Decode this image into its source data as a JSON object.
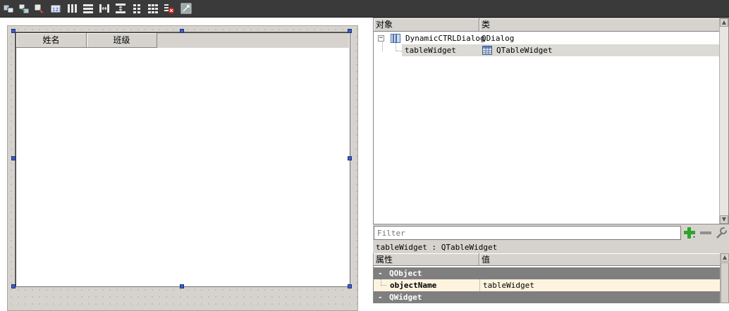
{
  "toolbar": {
    "buttons": [
      {
        "name": "edit-widgets",
        "icon": "edit-widgets-icon"
      },
      {
        "name": "edit-signals-slots",
        "icon": "signals-slots-icon"
      },
      {
        "name": "edit-buddies",
        "icon": "buddies-icon"
      },
      {
        "name": "edit-tab-order",
        "icon": "tab-order-icon"
      },
      {
        "name": "layout-horizontal",
        "icon": "layout-horizontal-icon"
      },
      {
        "name": "layout-vertical",
        "icon": "layout-vertical-icon"
      },
      {
        "name": "layout-horizontal-splitter",
        "icon": "splitter-horizontal-icon"
      },
      {
        "name": "layout-vertical-splitter",
        "icon": "splitter-vertical-icon"
      },
      {
        "name": "layout-form",
        "icon": "layout-form-icon"
      },
      {
        "name": "layout-grid",
        "icon": "layout-grid-icon"
      },
      {
        "name": "break-layout",
        "icon": "break-layout-icon"
      },
      {
        "name": "adjust-size",
        "icon": "adjust-size-icon"
      }
    ]
  },
  "form": {
    "table": {
      "columns": [
        "姓名",
        "班级"
      ]
    }
  },
  "object_inspector": {
    "headers": {
      "object": "对象",
      "class": "类"
    },
    "tree": [
      {
        "object": "DynamicCTRLDialog",
        "class": "QDialog",
        "icon": "dialog-icon",
        "expanded": true
      },
      {
        "object": "tableWidget",
        "class": "QTableWidget",
        "icon": "table-widget-icon",
        "selected": true
      }
    ]
  },
  "property_editor": {
    "filter_placeholder": "Filter",
    "add_icon": "plus-icon",
    "remove_icon": "minus-icon",
    "configure_icon": "wrench-icon",
    "current_object": "tableWidget : QTableWidget",
    "headers": {
      "property": "属性",
      "value": "值"
    },
    "groups": [
      {
        "name": "QObject",
        "properties": [
          {
            "name": "objectName",
            "value": "tableWidget"
          }
        ]
      },
      {
        "name": "QWidget",
        "properties": []
      }
    ]
  },
  "colors": {
    "toolbar_bg": "#3a3a3a",
    "handle": "#3d5ec9",
    "group_row": "#7f7f7f",
    "selected_row": "#dcdad5",
    "property_row": "#fdf3df",
    "add_green": "#2ea42e"
  }
}
